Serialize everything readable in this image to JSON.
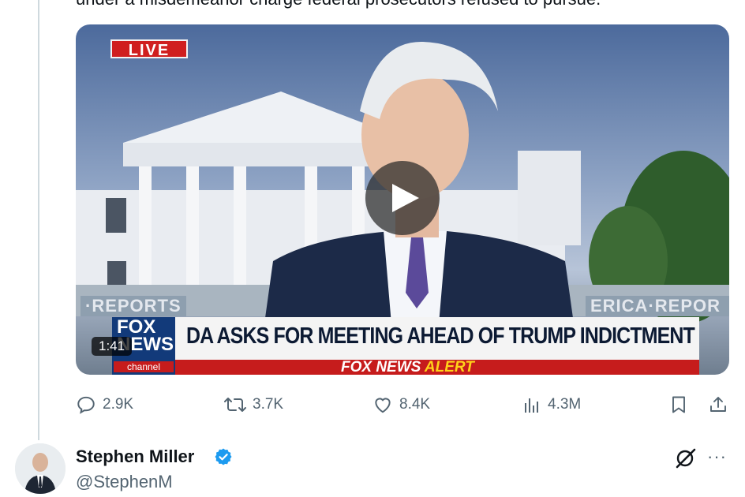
{
  "tweet": {
    "clipped_text": "under a misdemeanor charge federal prosecutors refused to pursue.",
    "video": {
      "live_badge": "LIVE",
      "reports_left": "·REPORTS",
      "reports_right": "ERICA·REPOR",
      "network_logo_line1": "FOX",
      "network_logo_line2": "NEWS",
      "network_logo_line3": "channel",
      "headline": "DA ASKS FOR MEETING AHEAD OF TRUMP INDICTMENT",
      "alert_brand": "FOX NEWS",
      "alert_word": "ALERT",
      "duration": "1:41",
      "play_icon": "play-icon"
    },
    "actions": {
      "replies": "2.9K",
      "retweets": "3.7K",
      "likes": "8.4K",
      "views": "4.3M"
    }
  },
  "next_tweet": {
    "author_name": "Stephen Miller",
    "author_handle": "@StephenM",
    "more_label": "···"
  },
  "colors": {
    "verified_blue": "#1d9bf0",
    "muted_text": "#536471",
    "thread_line": "#cfd9de"
  }
}
